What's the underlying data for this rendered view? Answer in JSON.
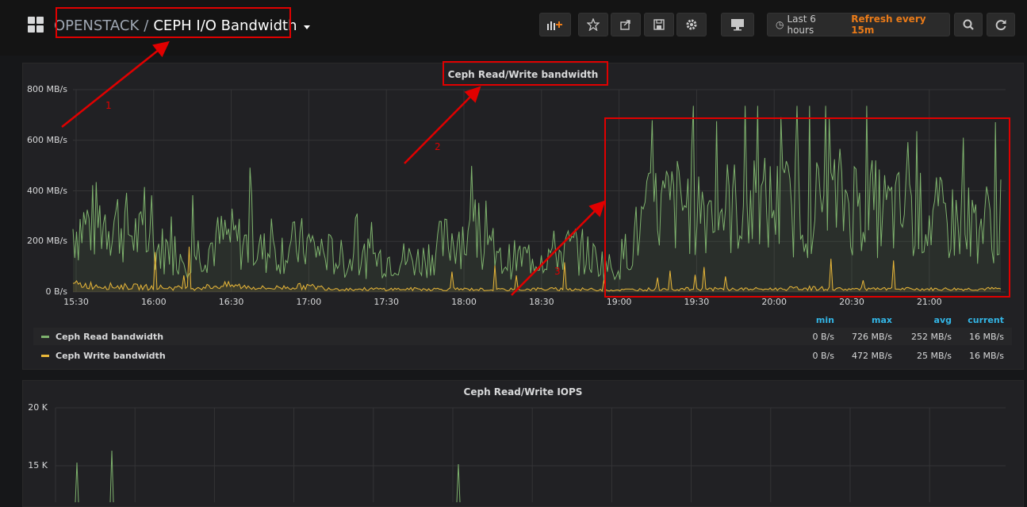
{
  "header": {
    "crumb": "OPENSTACK",
    "separator": "/",
    "title": "CEPH I/O Bandwidth",
    "time_range": "Last 6 hours",
    "refresh": "Refresh every 15m"
  },
  "colors": {
    "read": "#7eb26d",
    "write": "#eab839",
    "accent_orange": "#eb7b18",
    "legend_header": "#33b5e5",
    "annotation_red": "#e00000"
  },
  "panels": [
    {
      "title": "Ceph Read/Write bandwidth",
      "y_ticks": [
        "800 MB/s",
        "600 MB/s",
        "400 MB/s",
        "200 MB/s",
        "0 B/s"
      ],
      "x_ticks": [
        "15:30",
        "16:00",
        "16:30",
        "17:00",
        "17:30",
        "18:00",
        "18:30",
        "19:00",
        "19:30",
        "20:00",
        "20:30",
        "21:00"
      ],
      "legend_headers": [
        "min",
        "max",
        "avg",
        "current"
      ],
      "legend": [
        {
          "name": "Ceph Read bandwidth",
          "min": "0 B/s",
          "max": "726 MB/s",
          "avg": "252 MB/s",
          "current": "16 MB/s"
        },
        {
          "name": "Ceph Write bandwidth",
          "min": "0 B/s",
          "max": "472 MB/s",
          "avg": "25 MB/s",
          "current": "16 MB/s"
        }
      ]
    },
    {
      "title": "Ceph Read/Write IOPS",
      "y_ticks": [
        "20 K",
        "15 K"
      ]
    }
  ],
  "chart_data": [
    {
      "type": "line",
      "title": "Ceph Read/Write bandwidth",
      "ylabel": "",
      "ylim": [
        0,
        800
      ],
      "unit": "MB/s",
      "x": [
        "15:30",
        "15:45",
        "16:00",
        "16:15",
        "16:30",
        "16:45",
        "17:00",
        "17:15",
        "17:30",
        "17:45",
        "18:00",
        "18:15",
        "18:30",
        "18:45",
        "19:00",
        "19:15",
        "19:30",
        "19:45",
        "20:00",
        "20:15",
        "20:30",
        "20:45",
        "21:00",
        "21:15",
        "21:30"
      ],
      "series": [
        {
          "name": "Ceph Read bandwidth",
          "values": [
            280,
            330,
            200,
            160,
            240,
            170,
            210,
            140,
            150,
            140,
            260,
            130,
            160,
            190,
            100,
            360,
            390,
            370,
            380,
            370,
            410,
            350,
            330,
            300,
            310
          ]
        },
        {
          "name": "Ceph Write bandwidth",
          "values": [
            40,
            30,
            25,
            20,
            35,
            20,
            30,
            15,
            15,
            15,
            15,
            12,
            15,
            15,
            10,
            15,
            15,
            15,
            15,
            20,
            15,
            15,
            15,
            15,
            16
          ]
        }
      ],
      "grid": true
    }
  ],
  "annotations": [
    "1",
    "2",
    "3"
  ]
}
